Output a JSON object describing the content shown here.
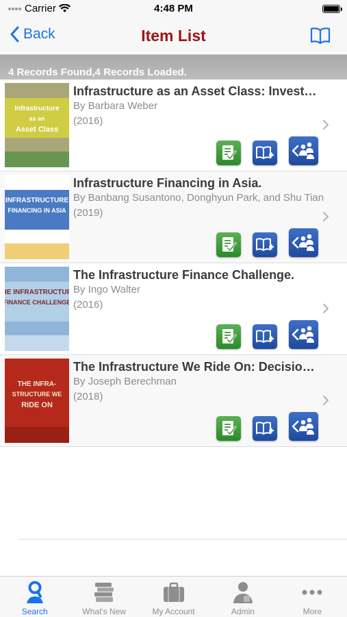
{
  "status": {
    "carrier": "Carrier",
    "time": "4:48 PM"
  },
  "nav": {
    "back_label": "Back",
    "title": "Item List"
  },
  "records_summary": "4 Records Found,4 Records Loaded.",
  "items": [
    {
      "title": "Infrastructure as an Asset Class: Invest…",
      "author": "By Barbara Weber",
      "year": "(2016)",
      "cover": {
        "bg": "#a9a77a",
        "band": "#d7d23a",
        "line1": "Infrastructure",
        "line2": "as an",
        "line3": "Asset Class",
        "text_color": "#ffffff",
        "accent": "#4c8f3e"
      }
    },
    {
      "title": "Infrastructure Financing in Asia.",
      "author": "By Banbang Susantono, Donghyun Park, and Shu Tian",
      "year": "(2019)",
      "cover": {
        "bg": "#ffffff",
        "band": "#2a63b8",
        "line1": "INFRASTRUCTURE",
        "line2": "FINANCING IN ASIA",
        "line3": "",
        "text_color": "#ffffff",
        "accent": "#e8b93a"
      }
    },
    {
      "title": "The Infrastructure Finance Challenge.",
      "author": "By Ingo Walter",
      "year": "(2016)",
      "cover": {
        "bg": "#8fb6d9",
        "band": "#b9d3ea",
        "line1": "THE INFRASTRUCTURE",
        "line2": "FINANCE CHALLENGE",
        "line3": "",
        "text_color": "#7a2a2a",
        "accent": "#dbe8f4"
      }
    },
    {
      "title": "The Infrastructure We Ride On: Decisio…",
      "author": "By Joseph Berechman",
      "year": "(2018)",
      "cover": {
        "bg": "#b5291c",
        "band": "#b5291c",
        "line1": "THE INFRA-",
        "line2": "STRUCTURE WE",
        "line3": "RIDE ON",
        "text_color": "#f3e6d2",
        "accent": "#8c1d13"
      }
    }
  ],
  "tabs": [
    {
      "label": "Search",
      "icon": "search-person-icon",
      "active": true
    },
    {
      "label": "What's New",
      "icon": "books-stack-icon",
      "active": false
    },
    {
      "label": "My Account",
      "icon": "briefcase-icon",
      "active": false
    },
    {
      "label": "Admin",
      "icon": "admin-person-icon",
      "active": false
    },
    {
      "label": "More",
      "icon": "more-dots-icon",
      "active": false
    }
  ],
  "colors": {
    "accent": "#1a73e8",
    "title_red": "#a01414",
    "action_green": "#2c8a2a",
    "action_blue": "#1d4a9e"
  }
}
